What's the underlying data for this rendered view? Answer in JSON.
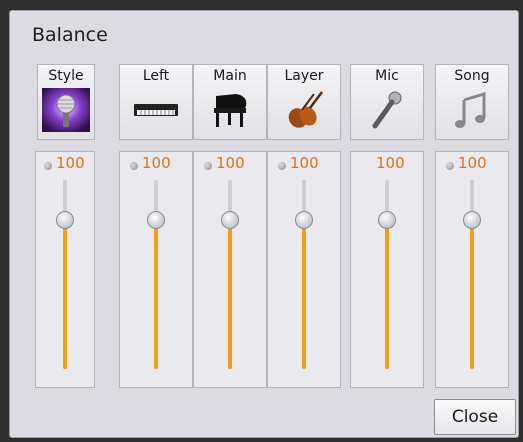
{
  "dialog": {
    "title": "Balance",
    "close_label": "Close"
  },
  "colors": {
    "value_text": "#e0701c",
    "slider_fill": "#f0a014",
    "panel_bg": "#dcdbe2"
  },
  "channels": [
    {
      "label": "Style",
      "icon": "style-microphone-icon",
      "value": "100",
      "level": 100,
      "led": true
    },
    {
      "label": "Left",
      "icon": "keyboard-icon",
      "value": "100",
      "level": 100,
      "led": true
    },
    {
      "label": "Main",
      "icon": "grand-piano-icon",
      "value": "100",
      "level": 100,
      "led": true
    },
    {
      "label": "Layer",
      "icon": "violin-icon",
      "value": "100",
      "level": 100,
      "led": true
    },
    {
      "label": "Mic",
      "icon": "microphone-icon",
      "value": "100",
      "level": 100,
      "led": false
    },
    {
      "label": "Song",
      "icon": "music-note-icon",
      "value": "100",
      "level": 100,
      "led": true
    }
  ]
}
